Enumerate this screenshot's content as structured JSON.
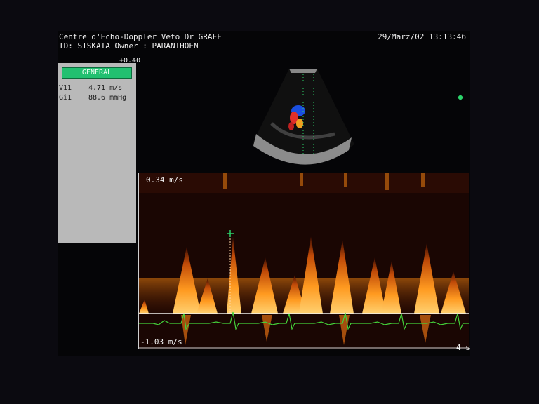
{
  "header": {
    "line1": "Centre d'Echo-Doppler Veto Dr GRAFF",
    "line2": "ID: SISKAIA Owner : PARANTHOEN",
    "datetime": "29/Marz/02 13:13:46"
  },
  "panel": {
    "tab_label": "GENERAL",
    "scale_top": "+0.40",
    "rows": [
      {
        "label": "V11",
        "value": "4.71 m/s"
      },
      {
        "label": "Gi1",
        "value": "88.6 mmHg"
      }
    ]
  },
  "doppler": {
    "top_velocity": "0.34 m/s",
    "bottom_velocity": "-1.03 m/s",
    "time_label": "4 s"
  },
  "colors": {
    "panel_tab": "#22c070",
    "ecg": "#44d23a",
    "spectrum": "#ff8a10",
    "marker": "#2bd36a"
  }
}
